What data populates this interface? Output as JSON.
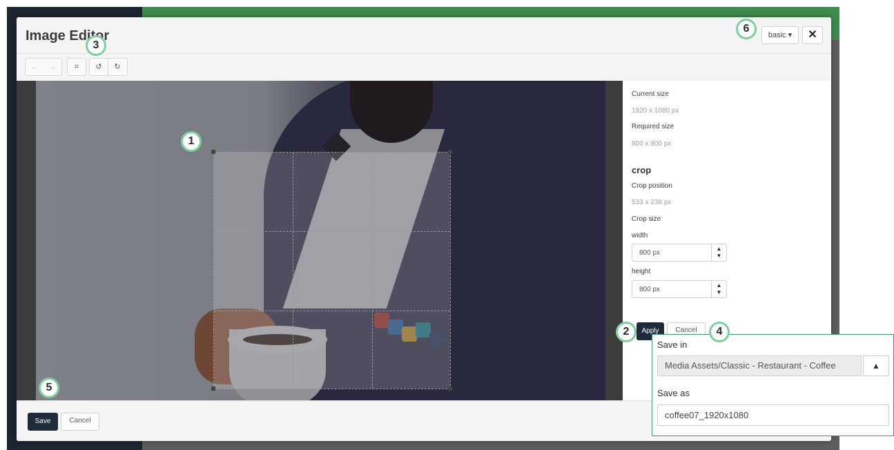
{
  "modal": {
    "title": "Image Editor",
    "mode_label": "basic ▾",
    "close_glyph": "✕"
  },
  "toolbar": {
    "undo_glyph": "←",
    "redo_glyph": "→",
    "crop_glyph": "⌗",
    "rotate_left_glyph": "↺",
    "rotate_right_glyph": "↻"
  },
  "panel": {
    "current_size_label": "Current size",
    "current_size_value": "1920 x 1080 px",
    "required_size_label": "Required size",
    "required_size_value": "800 x 800 px",
    "crop_heading": "crop",
    "crop_position_label": "Crop position",
    "crop_position_value": "533 x 238 px",
    "crop_size_label": "Crop size",
    "width_label": "width",
    "width_value": "800 px",
    "height_label": "height",
    "height_value": "800 px",
    "apply_label": "Apply",
    "cancel_label": "Cancel"
  },
  "footer": {
    "save_label": "Save",
    "cancel_label": "Cancel"
  },
  "save_dialog": {
    "save_in_label": "Save in",
    "save_in_value": "Media Assets/Classic - Restaurant - Coffee",
    "save_as_label": "Save as",
    "save_as_value": "coffee07_1920x1080"
  },
  "callouts": [
    "1",
    "2",
    "3",
    "4",
    "5",
    "6"
  ],
  "colors": {
    "accent": "#3e9a6e",
    "callout_ring": "#7ecf9c",
    "primary_button": "#1f2a3a",
    "topbar": "#3f8a4f"
  }
}
